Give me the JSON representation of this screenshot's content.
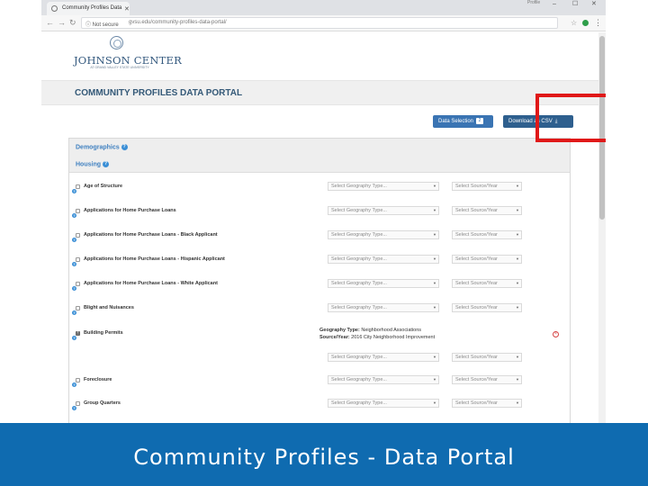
{
  "browser": {
    "tab_title": "Community Profiles Data",
    "user_label": "Profile",
    "not_secure": "Not secure",
    "url": "gvsu.edu/community-profiles-data-portal/",
    "controls": {
      "minimize": "–",
      "maximize": "☐",
      "close": "✕"
    }
  },
  "header": {
    "logo_text": "JOHNSON CENTER",
    "logo_subtitle": "AT GRAND VALLEY STATE UNIVERSITY",
    "portal_title": "COMMUNITY PROFILES DATA PORTAL"
  },
  "actions": {
    "data_selection": "Data Selection",
    "data_selection_count": "2",
    "download_csv": "Download as CSV"
  },
  "panel": {
    "category": "Demographics",
    "subcategory": "Housing",
    "geo_placeholder": "Select Geography Type...",
    "source_placeholder": "Select Source/Year",
    "rows": [
      {
        "label": "Age of Structure",
        "checked": false
      },
      {
        "label": "Applications for Home Purchase Loans",
        "checked": false
      },
      {
        "label": "Applications for Home Purchase Loans - Black Applicant",
        "checked": false
      },
      {
        "label": "Applications for Home Purchase Loans - Hispanic Applicant",
        "checked": false
      },
      {
        "label": "Applications for Home Purchase Loans - White Applicant",
        "checked": false
      },
      {
        "label": "Blight and Nuisances",
        "checked": false
      },
      {
        "label": "Building Permits",
        "checked": true
      },
      {
        "label": "Foreclosure",
        "checked": false
      },
      {
        "label": "Group Quarters",
        "checked": false
      }
    ],
    "building_permits_detail": {
      "geo_label": "Geography Type:",
      "geo_value": "Neighborhood Associations",
      "source_label": "Source/Year:",
      "source_value": "2016 City Neighborhood Improvement"
    }
  },
  "footer": {
    "title": "Community Profiles - Data Portal"
  },
  "colors": {
    "accent_blue": "#3a74b3",
    "footer_blue": "#0f6bb0",
    "highlight_red": "#e01818",
    "title_blue": "#345978"
  }
}
